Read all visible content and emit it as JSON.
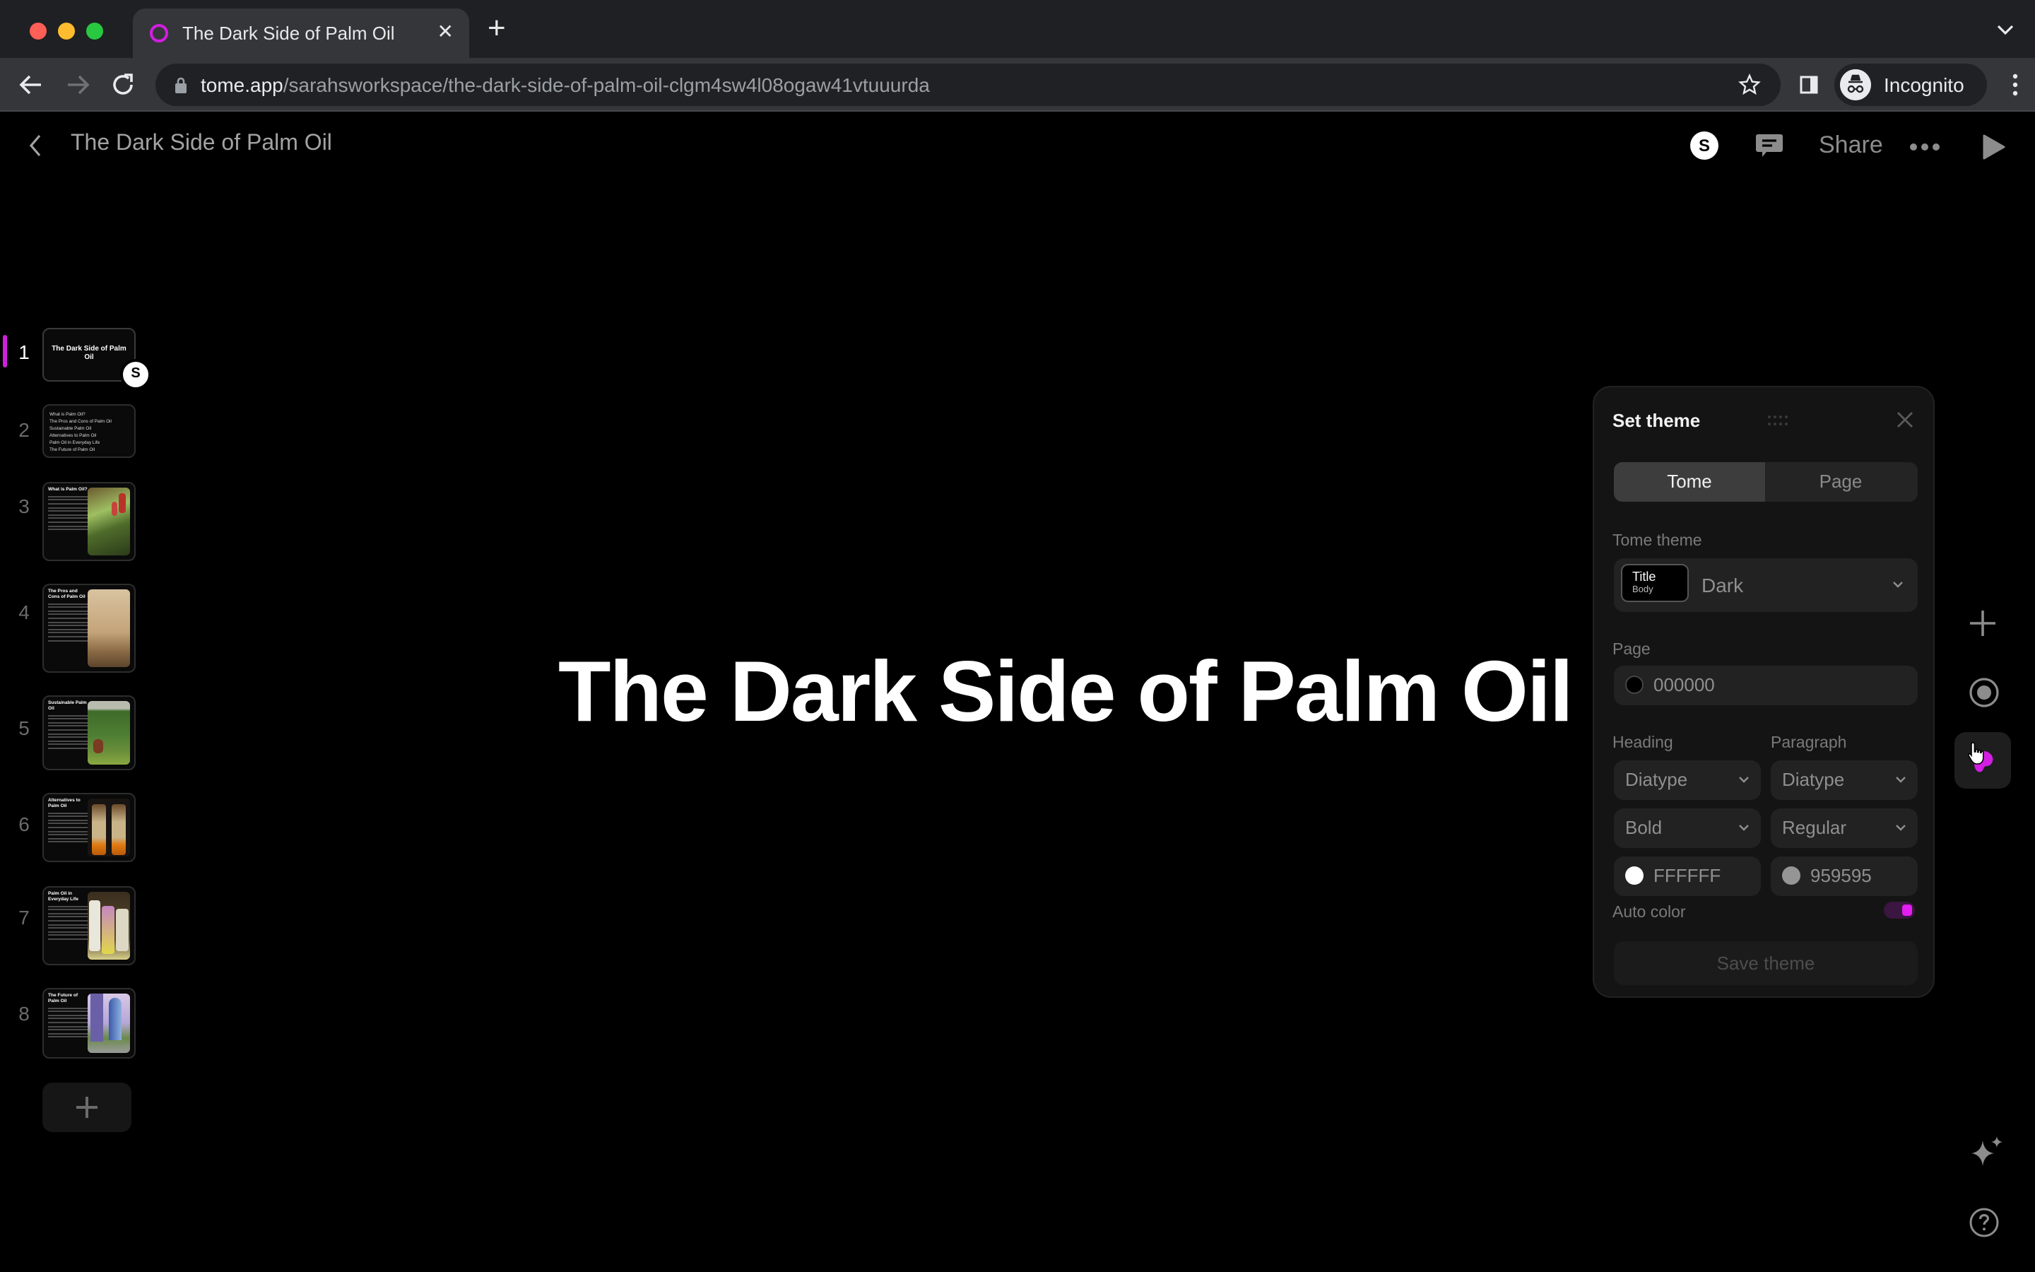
{
  "browser": {
    "tab_title": "The Dark Side of Palm Oil",
    "tab_close_icon": "close-icon",
    "new_tab_icon": "plus-icon",
    "url_host": "tome.app",
    "url_path": "/sarahsworkspace/the-dark-side-of-palm-oil-clgm4sw4l08ogaw41vtuuurda",
    "profile_label": "Incognito"
  },
  "app": {
    "doc_title": "The Dark Side of Palm Oil",
    "user_initial": "S",
    "share_label": "Share"
  },
  "pages": [
    {
      "number": "1",
      "kind": "title",
      "title": "The Dark Side of Palm Oil",
      "active": true
    },
    {
      "number": "2",
      "kind": "toc",
      "items": [
        "What is Palm Oil?",
        "The Pros and Cons of Palm Oil",
        "Sustainable Palm Oil",
        "Alternatives to Palm Oil",
        "Palm Oil in Everyday Life",
        "The Future of Palm Oil"
      ]
    },
    {
      "number": "3",
      "kind": "text-image",
      "title": "What is Palm Oil?",
      "image": "rainforest with red palm fruit"
    },
    {
      "number": "4",
      "kind": "text-image",
      "title": "The Pros and Cons of Palm Oil",
      "image": "hazy deforested landscape"
    },
    {
      "number": "5",
      "kind": "text-image",
      "title": "Sustainable Palm Oil",
      "image": "palm oil plantation"
    },
    {
      "number": "6",
      "kind": "text-image",
      "title": "Alternatives to Palm Oil",
      "image": "two oil bottles"
    },
    {
      "number": "7",
      "kind": "text-image",
      "title": "Palm Oil in Everyday Life",
      "image": "product cans on shelf"
    },
    {
      "number": "8",
      "kind": "text-image",
      "title": "The Future of Palm Oil",
      "image": "futuristic city towers"
    }
  ],
  "canvas": {
    "title": "The Dark Side of Palm Oil"
  },
  "theme_panel": {
    "title": "Set theme",
    "tabs": [
      {
        "label": "Tome",
        "selected": true
      },
      {
        "label": "Page",
        "selected": false
      }
    ],
    "tome_theme_label": "Tome theme",
    "swatch_title": "Title",
    "swatch_body": "Body",
    "theme_value": "Dark",
    "page_label": "Page",
    "page_color": "000000",
    "heading_label": "Heading",
    "paragraph_label": "Paragraph",
    "heading_font": "Diatype",
    "paragraph_font": "Diatype",
    "heading_weight": "Bold",
    "paragraph_weight": "Regular",
    "heading_color": "FFFFFF",
    "paragraph_color": "959595",
    "auto_color_label": "Auto color",
    "auto_color_on": true,
    "save_label": "Save theme"
  },
  "colors": {
    "accent": "#d21ee1",
    "page_background": "#000000",
    "heading": "#FFFFFF",
    "paragraph": "#959595"
  }
}
